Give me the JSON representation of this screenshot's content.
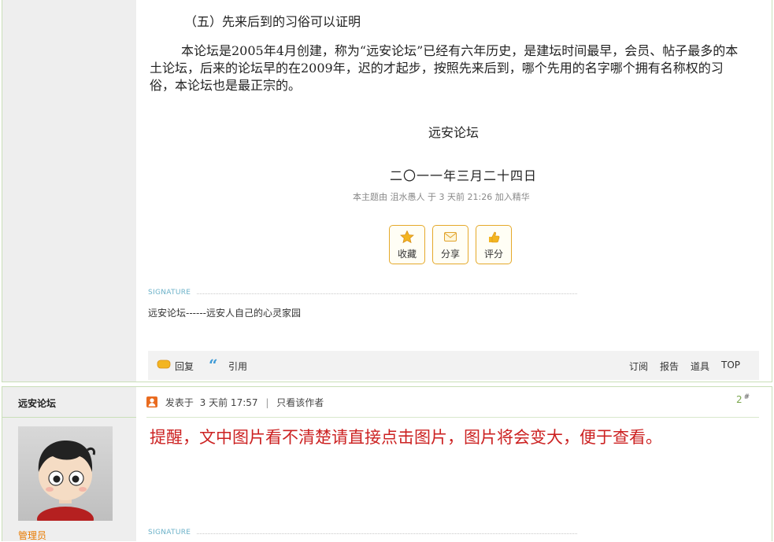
{
  "post1": {
    "section_heading": "（五）先来后到的习俗可以证明",
    "paragraph": "本论坛是2005年4月创建，称为“远安论坛”已经有六年历史，是建坛时间最早，会员、帖子最多的本土论坛，后来的论坛早的在2009年，迟的才起步，按照先来后到，哪个先用的名字哪个拥有名称权的习俗，本论坛也是最正宗的。",
    "signoff_name": "远安论坛",
    "signoff_date": "二〇一一年三月二十四日",
    "meta": {
      "prefix": "本主题由",
      "user": "沮水愚人",
      "on": "于",
      "time": "3 天前 21:26",
      "action": "加入精华"
    },
    "actions": [
      {
        "label": "收藏",
        "icon": "star-icon"
      },
      {
        "label": "分享",
        "icon": "share-icon"
      },
      {
        "label": "评分",
        "icon": "rate-icon"
      }
    ],
    "signature_label": "SIGNATURE",
    "signature_text": "远安论坛------远安人自己的心灵家园",
    "bar": {
      "reply": "回复",
      "quote": "引用",
      "subscribe": "订阅",
      "report": "报告",
      "tools": "道具",
      "top": "TOP"
    }
  },
  "post2": {
    "author": "远安论坛",
    "role": "管理员",
    "posted_prefix": "发表于",
    "posted_time": "3 天前 17:57",
    "separator": "|",
    "only_author": "只看该作者",
    "floor_number": "2",
    "floor_mark": "#",
    "content": "提醒，文中图片看不清楚请直接点击图片，图片将会变大，便于查看。",
    "signature_label": "SIGNATURE"
  },
  "colors": {
    "accent_green": "#7aa64c",
    "reminder_red": "#cc2222",
    "button_border": "#e5a92a",
    "signature_blue": "#6bb1c8",
    "role_orange": "#e87a00"
  }
}
